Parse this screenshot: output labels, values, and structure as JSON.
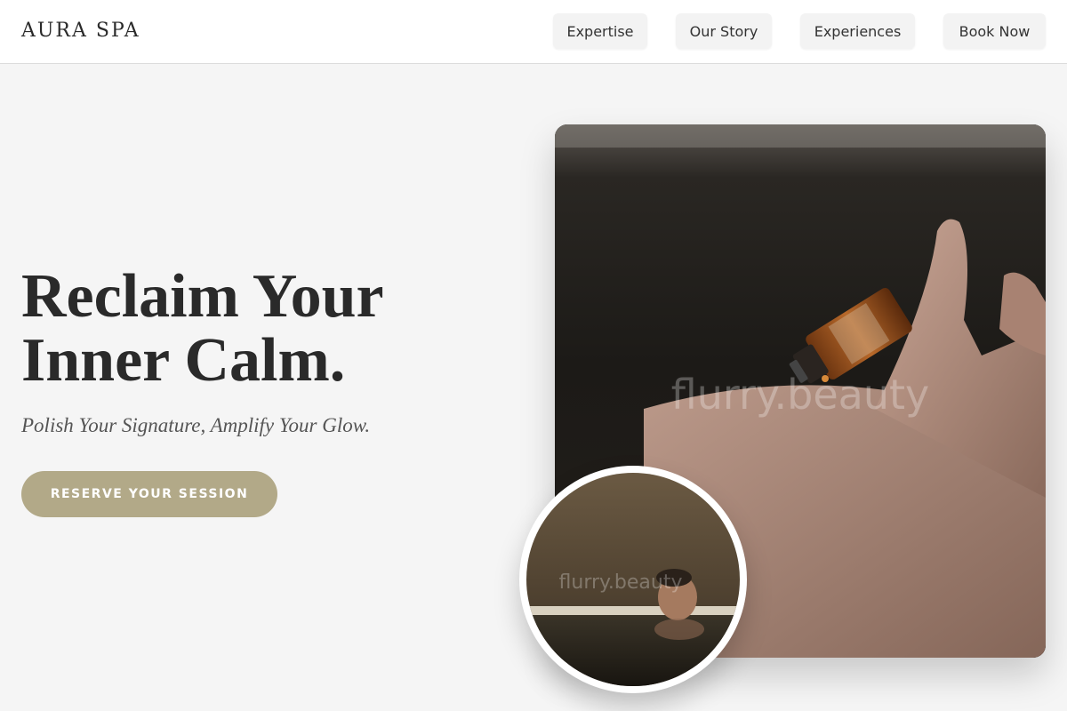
{
  "brand": {
    "name": "AURA SPA"
  },
  "nav": {
    "items": [
      {
        "label": "Expertise"
      },
      {
        "label": "Our Story"
      },
      {
        "label": "Experiences"
      },
      {
        "label": "Book Now"
      }
    ]
  },
  "hero": {
    "title_line1": "Reclaim Your",
    "title_line2": "Inner Calm.",
    "subtitle": "Polish Your Signature, Amplify Your Glow.",
    "cta_label": "RESERVE YOUR SESSION",
    "image_watermark": "flurry.beauty",
    "circle_watermark": "flurry.beauty"
  },
  "colors": {
    "accent": "#b2a988",
    "background": "#f5f5f5",
    "nav_background": "#ffffff"
  }
}
